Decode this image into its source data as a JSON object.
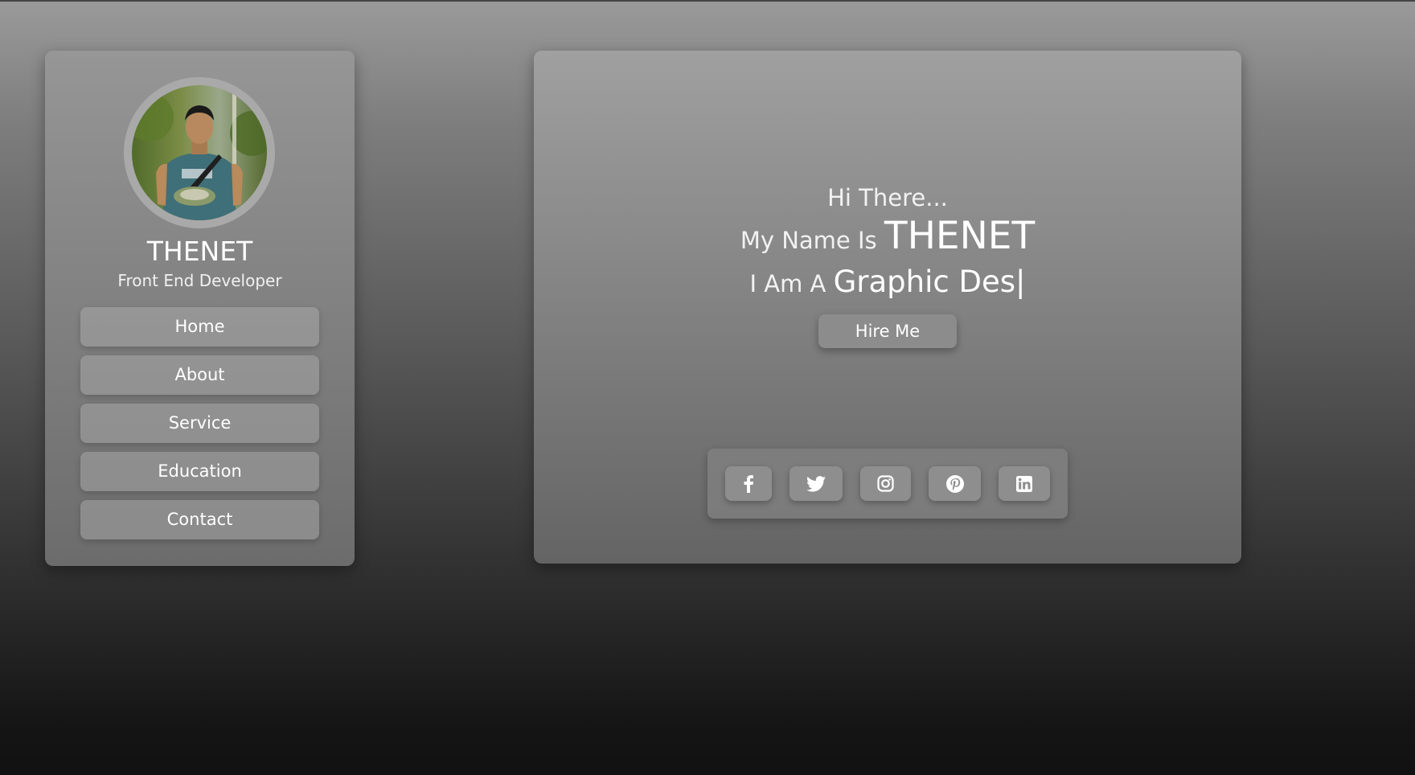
{
  "profile": {
    "name": "THENET",
    "role": "Front End Developer",
    "avatar": "profile-photo"
  },
  "nav": {
    "items": [
      {
        "label": "Home"
      },
      {
        "label": "About"
      },
      {
        "label": "Service"
      },
      {
        "label": "Education"
      },
      {
        "label": "Contact"
      }
    ]
  },
  "hero": {
    "greeting": "Hi There...",
    "name_prefix": "My Name Is",
    "name": "THENET",
    "role_prefix": "I Am A",
    "role_typed": "Graphic Des|",
    "hire_label": "Hire Me"
  },
  "social": {
    "icons": [
      "facebook-icon",
      "twitter-icon",
      "instagram-icon",
      "pinterest-icon",
      "linkedin-icon"
    ]
  }
}
